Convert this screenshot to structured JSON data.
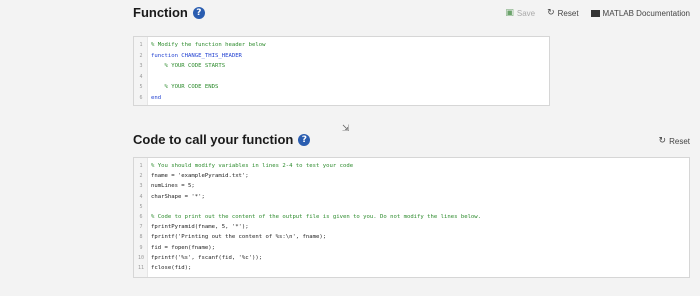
{
  "function_section": {
    "title": "Function",
    "toolbar": {
      "save_label": "Save",
      "reset_label": "Reset",
      "docs_label": "MATLAB Documentation"
    },
    "lines": [
      {
        "n": "1",
        "text": "% Modify the function header below",
        "cls": "comment"
      },
      {
        "n": "2",
        "text": "function CHANGE_THIS_HEADER",
        "cls": "kw"
      },
      {
        "n": "3",
        "text": "    % YOUR CODE STARTS",
        "cls": "comment"
      },
      {
        "n": "4",
        "text": "",
        "cls": ""
      },
      {
        "n": "5",
        "text": "    % YOUR CODE ENDS",
        "cls": "comment"
      },
      {
        "n": "6",
        "text": "end",
        "cls": "kw"
      }
    ]
  },
  "call_section": {
    "title": "Code to call your function",
    "reset_label": "Reset",
    "lines": [
      {
        "n": "1",
        "text": "% You should modify variables in lines 2-4 to test your code",
        "cls": "comment"
      },
      {
        "n": "2",
        "text": "fname = 'examplePyramid.txt';",
        "cls": ""
      },
      {
        "n": "3",
        "text": "numLines = 5;",
        "cls": ""
      },
      {
        "n": "4",
        "text": "charShape = '*';",
        "cls": ""
      },
      {
        "n": "5",
        "text": "",
        "cls": ""
      },
      {
        "n": "6",
        "text": "% Code to print out the content of the output file is given to you. Do not modify the lines below.",
        "cls": "comment"
      },
      {
        "n": "7",
        "text": "fprintPyramid(fname, 5, '*');",
        "cls": ""
      },
      {
        "n": "8",
        "text": "fprintf('Printing out the content of %s:\\n', fname);",
        "cls": ""
      },
      {
        "n": "9",
        "text": "fid = fopen(fname);",
        "cls": ""
      },
      {
        "n": "10",
        "text": "fprintf('%s', fscanf(fid, '%c'));",
        "cls": ""
      },
      {
        "n": "11",
        "text": "fclose(fid);",
        "cls": ""
      }
    ]
  }
}
